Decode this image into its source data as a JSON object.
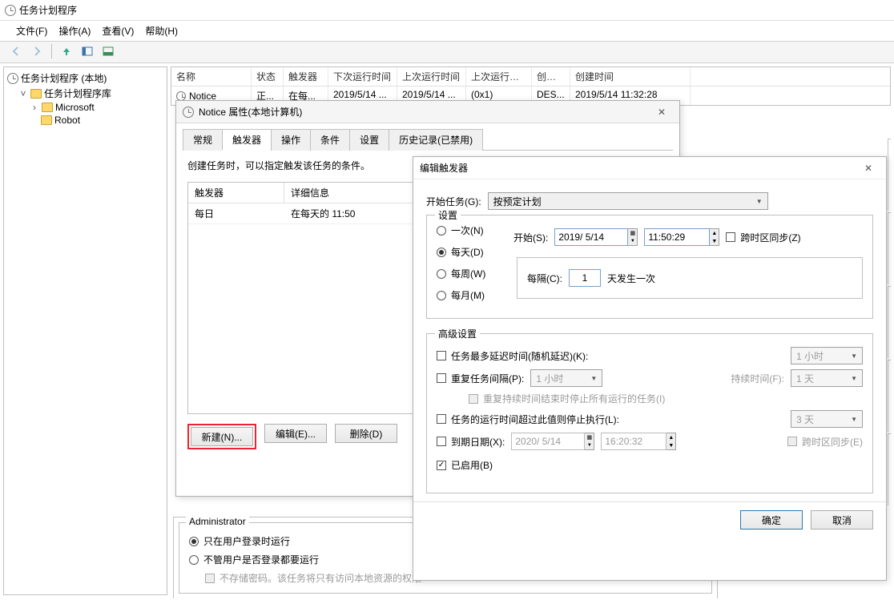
{
  "window": {
    "title": "任务计划程序"
  },
  "menu": {
    "file": "文件(F)",
    "action": "操作(A)",
    "view": "查看(V)",
    "help": "帮助(H)"
  },
  "tree": {
    "root": "任务计划程序 (本地)",
    "lib": "任务计划程序库",
    "microsoft": "Microsoft",
    "robot": "Robot"
  },
  "grid": {
    "headers": {
      "name": "名称",
      "status": "状态",
      "trigger": "触发器",
      "next": "下次运行时间",
      "last": "上次运行时间",
      "result": "上次运行结果",
      "creator": "创建者",
      "ctime": "创建时间"
    },
    "row": {
      "name": "Notice",
      "status": "正...",
      "trigger": "在每...",
      "next": "2019/5/14 ...",
      "last": "2019/5/14 ...",
      "result": "(0x1)",
      "creator": "DES...",
      "ctime": "2019/5/14 11:32:28"
    }
  },
  "dlg1": {
    "title": "Notice 属性(本地计算机)",
    "tabs": {
      "general": "常规",
      "triggers": "触发器",
      "actions": "操作",
      "conditions": "条件",
      "settings": "设置",
      "history": "历史记录(已禁用)"
    },
    "hint": "创建任务时，可以指定触发该任务的条件。",
    "thead": {
      "trigger": "触发器",
      "detail": "详细信息"
    },
    "trow": {
      "trigger": "每日",
      "detail": "在每天的 11:50"
    },
    "btns": {
      "new": "新建(N)...",
      "edit": "编辑(E)...",
      "delete": "删除(D)"
    }
  },
  "dlg2": {
    "title": "编辑触发器",
    "begin_task_label": "开始任务(G):",
    "begin_task_value": "按预定计划",
    "settings_legend": "设置",
    "freq": {
      "once": "一次(N)",
      "daily": "每天(D)",
      "weekly": "每周(W)",
      "monthly": "每月(M)"
    },
    "start_label": "开始(S):",
    "date": "2019/ 5/14",
    "time": "11:50:29",
    "sync_tz": "跨时区同步(Z)",
    "every_label": "每隔(C):",
    "every_value": "1",
    "every_suffix": "天发生一次",
    "adv_legend": "高级设置",
    "adv": {
      "delay_label": "任务最多延迟时间(随机延迟)(K):",
      "delay_val": "1 小时",
      "repeat_label": "重复任务间隔(P):",
      "repeat_val": "1 小时",
      "duration_label": "持续时间(F):",
      "duration_val": "1 天",
      "stop_all": "重复持续时间结束时停止所有运行的任务(I)",
      "stop_if_label": "任务的运行时间超过此值则停止执行(L):",
      "stop_if_val": "3 天",
      "expire_label": "到期日期(X):",
      "expire_date": "2020/ 5/14",
      "expire_time": "16:20:32",
      "expire_sync": "跨时区同步(E)",
      "enabled": "已启用(B)"
    },
    "ok": "确定",
    "cancel": "取消"
  },
  "admin": {
    "legend": "Administrator",
    "opt1": "只在用户登录时运行",
    "opt2": "不管用户是否登录都要运行",
    "opt3": "不存储密码。该任务将只有访问本地资源的权限"
  }
}
